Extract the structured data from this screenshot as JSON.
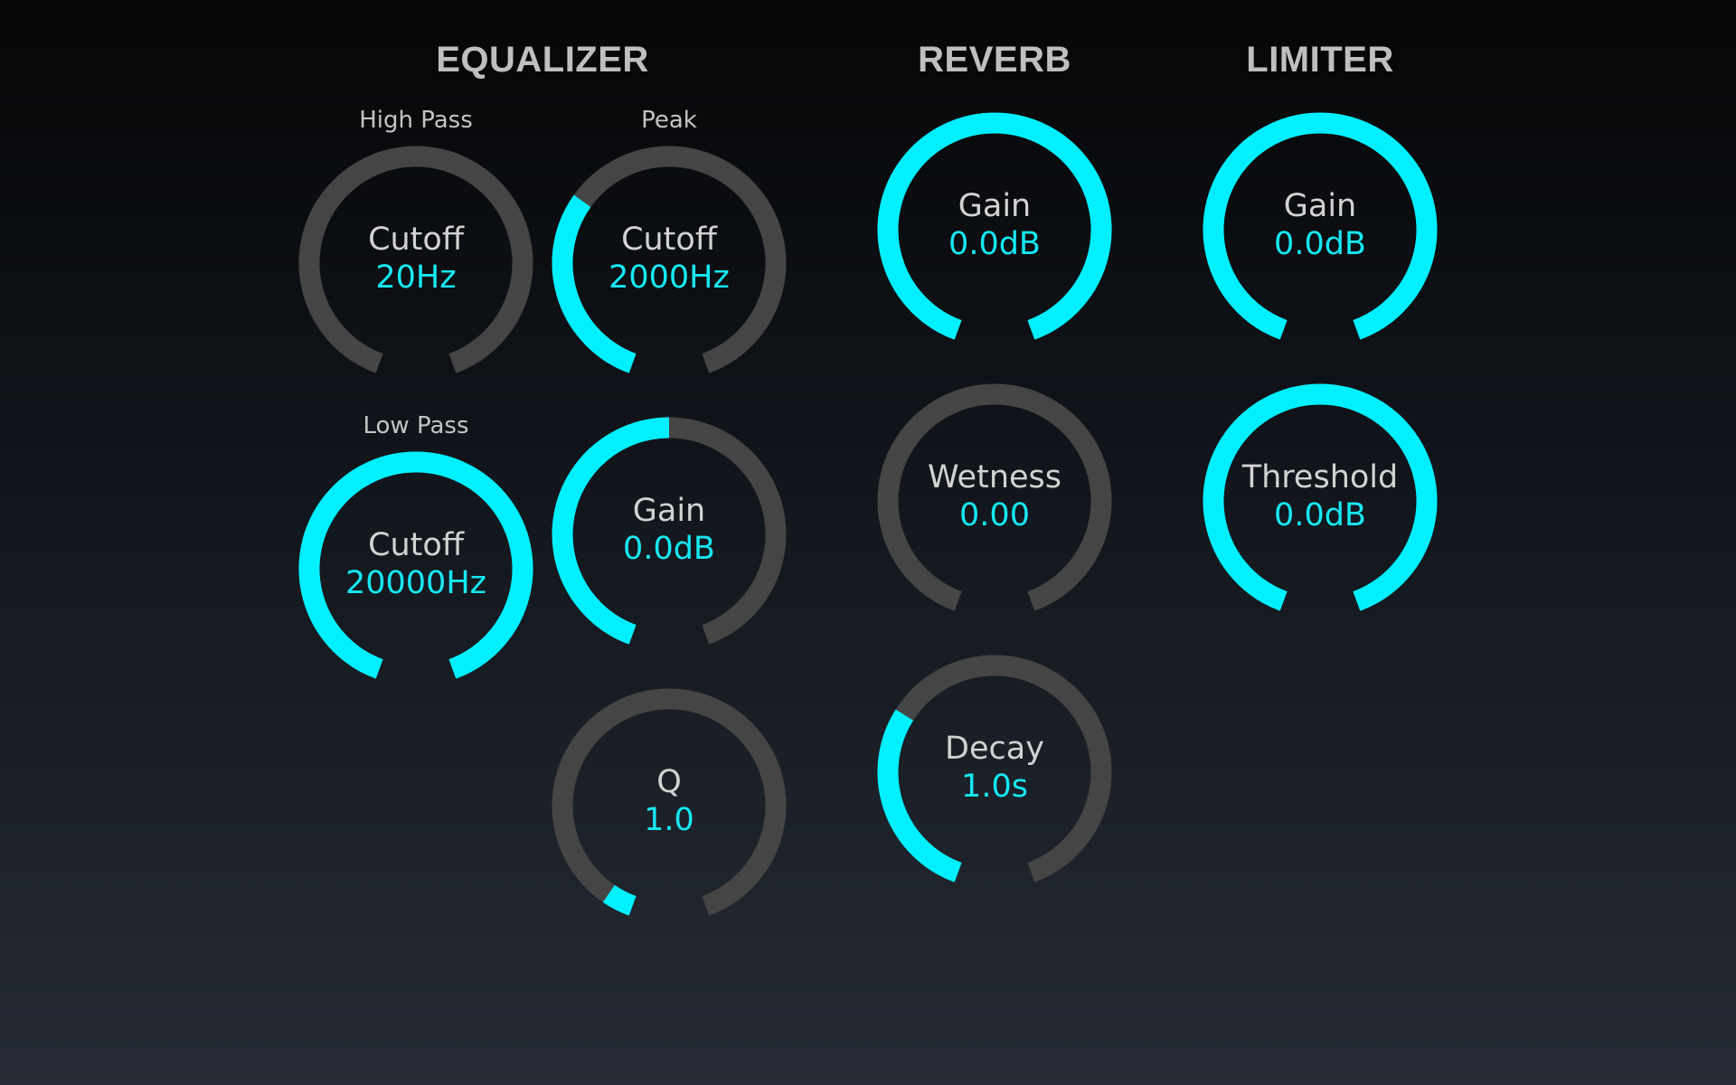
{
  "colors": {
    "accent": "#00f0ff",
    "track": "#454545",
    "label": "#d2d2d2",
    "value": "#16e8f2"
  },
  "sections": [
    {
      "id": "equalizer",
      "title": "EQUALIZER",
      "groups": [
        {
          "id": "high-pass",
          "label": "High Pass"
        },
        {
          "id": "peak",
          "label": "Peak"
        },
        {
          "id": "low-pass",
          "label": "Low Pass"
        }
      ]
    },
    {
      "id": "reverb",
      "title": "REVERB",
      "groups": []
    },
    {
      "id": "limiter",
      "title": "LIMITER",
      "groups": []
    }
  ],
  "knobs": [
    {
      "id": "eq-highpass-cutoff",
      "label": "Cutoff",
      "value": "20Hz",
      "level": 0.0
    },
    {
      "id": "eq-peak-cutoff",
      "label": "Cutoff",
      "value": "2000Hz",
      "level": 0.33
    },
    {
      "id": "eq-lowpass-cutoff",
      "label": "Cutoff",
      "value": "20000Hz",
      "level": 1.0
    },
    {
      "id": "eq-peak-gain",
      "label": "Gain",
      "value": "0.0dB",
      "level": 0.5
    },
    {
      "id": "eq-peak-q",
      "label": "Q",
      "value": "1.0",
      "level": 0.045
    },
    {
      "id": "reverb-gain",
      "label": "Gain",
      "value": "0.0dB",
      "level": 1.0
    },
    {
      "id": "reverb-wetness",
      "label": "Wetness",
      "value": "0.00",
      "level": 0.0
    },
    {
      "id": "reverb-decay",
      "label": "Decay",
      "value": "1.0s",
      "level": 0.32
    },
    {
      "id": "limiter-gain",
      "label": "Gain",
      "value": "0.0dB",
      "level": 1.0
    },
    {
      "id": "limiter-threshold",
      "label": "Threshold",
      "value": "0.0dB",
      "level": 1.0
    }
  ]
}
